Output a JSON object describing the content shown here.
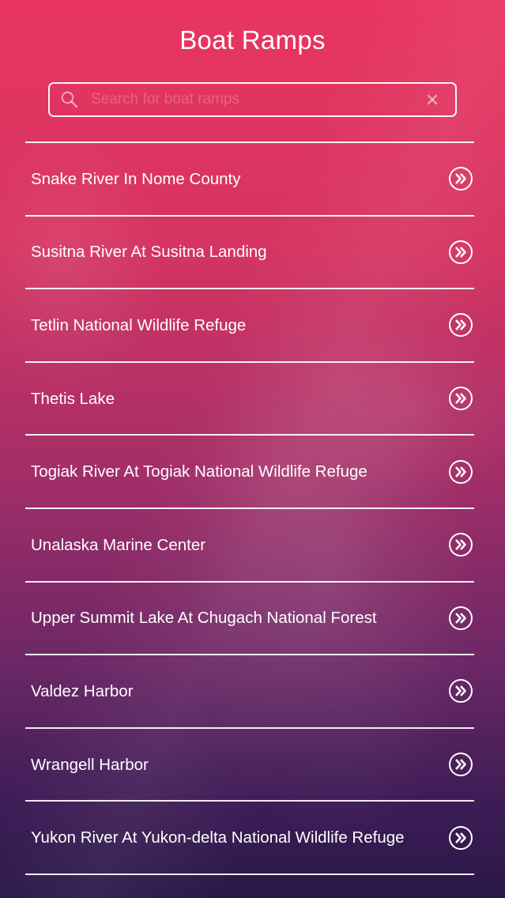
{
  "header": {
    "title": "Boat Ramps"
  },
  "search": {
    "placeholder": "Search for boat ramps",
    "value": ""
  },
  "icons": {
    "search": "search-icon",
    "clear": "close-icon",
    "row": "double-chevron-right-icon"
  },
  "colors": {
    "gradient_top": "#e8355f",
    "gradient_bottom": "#2a1748",
    "text": "#ffffff"
  },
  "list": {
    "items": [
      {
        "label": "Snake River In Nome County"
      },
      {
        "label": "Susitna River At Susitna Landing"
      },
      {
        "label": "Tetlin National Wildlife Refuge"
      },
      {
        "label": "Thetis Lake"
      },
      {
        "label": "Togiak River At Togiak National Wildlife Refuge"
      },
      {
        "label": "Unalaska Marine Center"
      },
      {
        "label": "Upper Summit Lake At Chugach National Forest"
      },
      {
        "label": "Valdez Harbor"
      },
      {
        "label": "Wrangell Harbor"
      },
      {
        "label": "Yukon River At Yukon-delta National Wildlife Refuge"
      }
    ]
  }
}
